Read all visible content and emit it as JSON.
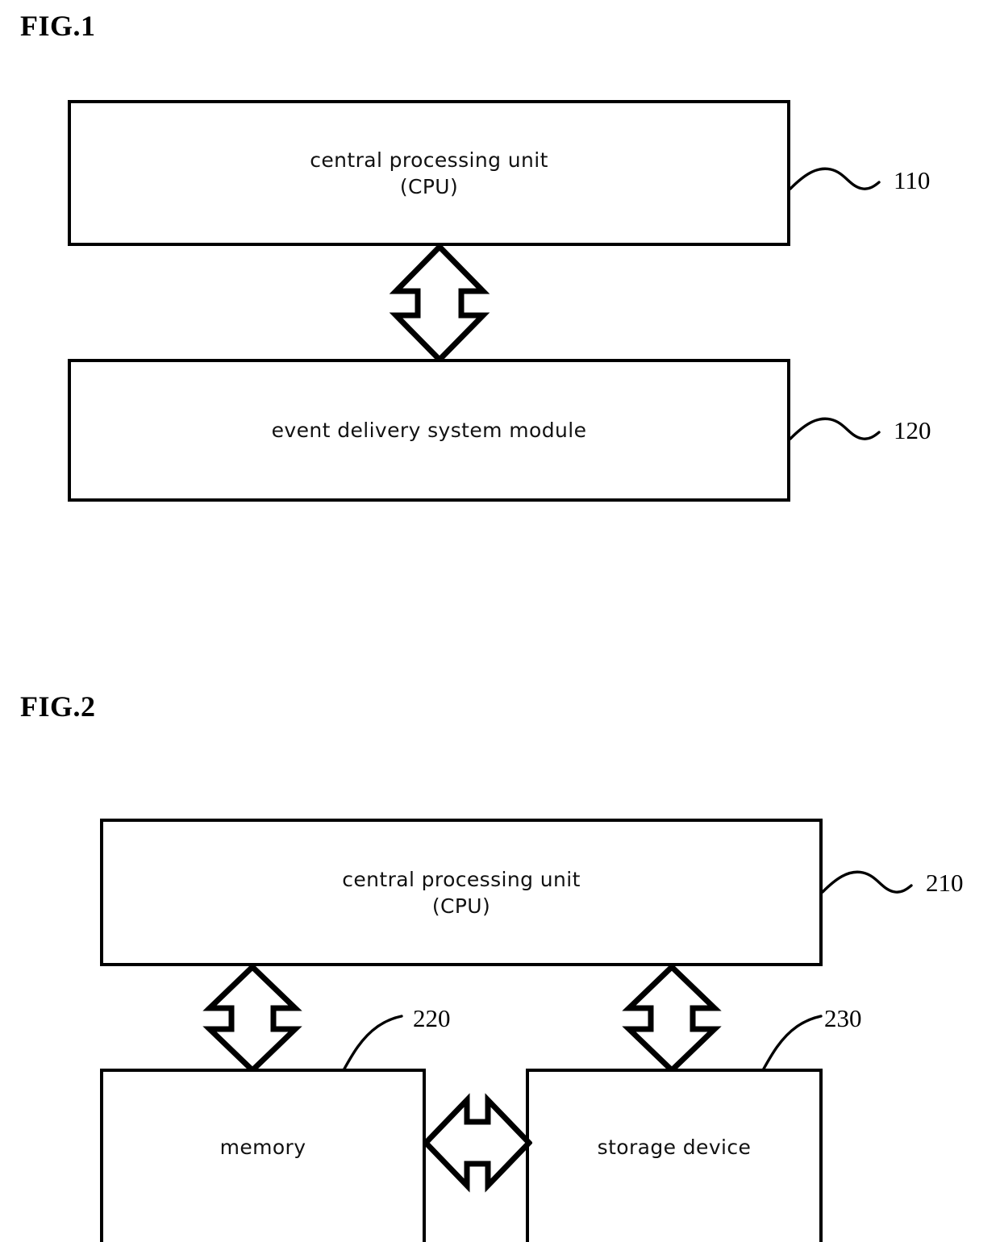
{
  "document": {
    "type": "patent-drawing-sheet",
    "background_color": "#ffffff",
    "line_color": "#000000"
  },
  "figures": [
    {
      "id": "fig-1",
      "label": "FIG.1",
      "blocks": [
        {
          "name": "cpu",
          "label": "central processing  unit\n(CPU)",
          "ref": "110"
        },
        {
          "name": "event-delivery-system-module",
          "label": "event delivery system module",
          "ref": "120"
        }
      ],
      "connectors": [
        {
          "name": "cpu-to-event-delivery-connector",
          "style": "double-headed-block-arrow",
          "orientation": "vertical"
        }
      ]
    },
    {
      "id": "fig-2",
      "label": "FIG.2",
      "blocks": [
        {
          "name": "cpu",
          "label": "central processing  unit\n(CPU)",
          "ref": "210"
        },
        {
          "name": "memory",
          "label": "memory",
          "ref": "220"
        },
        {
          "name": "storage-device",
          "label": "storage device",
          "ref": "230"
        }
      ],
      "connectors": [
        {
          "name": "cpu-to-memory-connector",
          "style": "double-headed-block-arrow",
          "orientation": "vertical"
        },
        {
          "name": "cpu-to-storage-connector",
          "style": "double-headed-block-arrow",
          "orientation": "vertical"
        },
        {
          "name": "memory-to-storage-connector",
          "style": "double-headed-block-arrow",
          "orientation": "horizontal"
        }
      ]
    }
  ]
}
